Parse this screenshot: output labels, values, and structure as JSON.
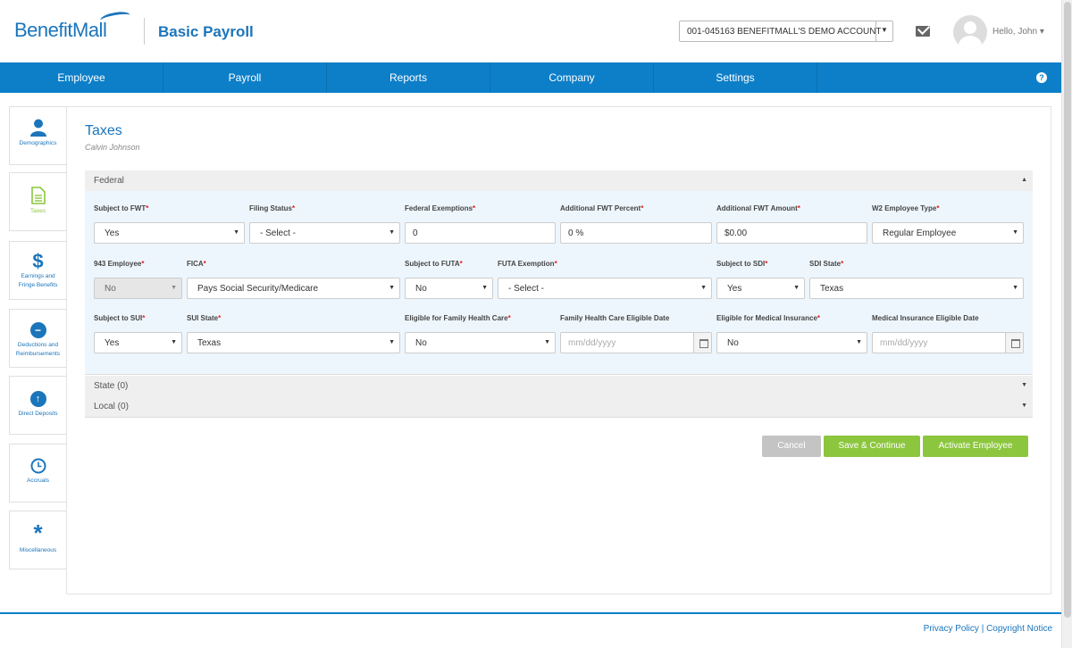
{
  "header": {
    "logo_text": "BenefitMall",
    "app_name": "Basic Payroll",
    "account": "001-045163 BENEFITMALL'S DEMO ACCOUNT",
    "greeting": "Hello, John"
  },
  "nav": {
    "items": [
      "Employee",
      "Payroll",
      "Reports",
      "Company",
      "Settings"
    ],
    "help": "?"
  },
  "sidebar": {
    "items": [
      {
        "label": "Demographics"
      },
      {
        "label": "Taxes"
      },
      {
        "label_line1": "Earnings and",
        "label_line2": "Fringe Benefits"
      },
      {
        "label_line1": "Deductions and",
        "label_line2": "Reimbursements"
      },
      {
        "label": "Direct Deposits"
      },
      {
        "label": "Accruals"
      },
      {
        "label": "Miscellaneous"
      }
    ]
  },
  "page": {
    "title": "Taxes",
    "subtitle": "Calvin Johnson"
  },
  "sections": {
    "federal": "Federal",
    "state": "State (0)",
    "local": "Local (0)"
  },
  "form": {
    "subject_fwt": {
      "label": "Subject to FWT",
      "value": "Yes"
    },
    "filing_status": {
      "label": "Filing Status",
      "value": "- Select -"
    },
    "federal_exemptions": {
      "label": "Federal Exemptions",
      "value": "0"
    },
    "additional_fwt_percent": {
      "label": "Additional FWT Percent",
      "value": "0 %"
    },
    "additional_fwt_amount": {
      "label": "Additional FWT Amount",
      "value": "$0.00"
    },
    "w2_employee_type": {
      "label": "W2 Employee Type",
      "value": "Regular Employee"
    },
    "employee_943": {
      "label": "943 Employee",
      "value": "No"
    },
    "fica": {
      "label": "FICA",
      "value": "Pays Social Security/Medicare"
    },
    "subject_futa": {
      "label": "Subject to FUTA",
      "value": "No"
    },
    "futa_exemption": {
      "label": "FUTA Exemption",
      "value": "- Select -"
    },
    "subject_sdi": {
      "label": "Subject to SDI",
      "value": "Yes"
    },
    "sdi_state": {
      "label": "SDI State",
      "value": "Texas"
    },
    "subject_sui": {
      "label": "Subject to SUI",
      "value": "Yes"
    },
    "sui_state": {
      "label": "SUI State",
      "value": "Texas"
    },
    "family_health_care": {
      "label": "Eligible for Family Health Care",
      "value": "No"
    },
    "family_health_date": {
      "label": "Family Health Care Eligible Date",
      "placeholder": "mm/dd/yyyy"
    },
    "medical_insurance": {
      "label": "Eligible for Medical Insurance",
      "value": "No"
    },
    "medical_insurance_date": {
      "label": "Medical Insurance Eligible Date",
      "placeholder": "mm/dd/yyyy"
    }
  },
  "buttons": {
    "cancel": "Cancel",
    "save": "Save & Continue",
    "activate": "Activate Employee"
  },
  "footer": {
    "privacy": "Privacy Policy",
    "separator": "|",
    "copyright": "Copyright Notice"
  },
  "colors": {
    "brand_blue": "#0d7fc8",
    "accent_green": "#8cc63e",
    "required_red": "#e02020"
  }
}
